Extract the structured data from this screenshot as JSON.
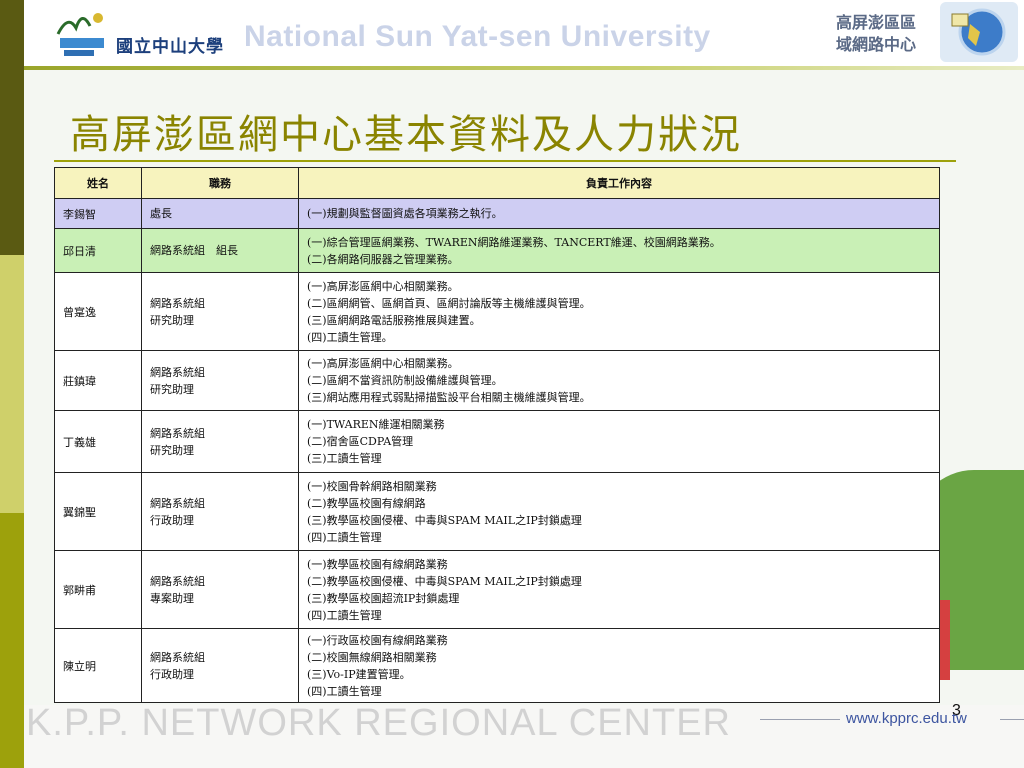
{
  "header": {
    "university_cn": "國立中山大學",
    "university_en": "National Sun Yat-sen University",
    "center_name_line1": "高屏澎區區",
    "center_name_line2": "域網路中心"
  },
  "title": "高屏澎區網中心基本資料及人力狀況",
  "table": {
    "headers": [
      "姓名",
      "職務",
      "負責工作內容"
    ],
    "rows": [
      {
        "name": "李錫智",
        "role": [
          "處長"
        ],
        "duties": [
          "(一)規劃與監督圖資處各項業務之執行。"
        ]
      },
      {
        "name": "邱日清",
        "role": [
          "網路系統組　組長"
        ],
        "duties": [
          "(一)綜合管理區網業務、TWAREN網路維運業務、TANCERT維運、校園網路業務。",
          "(二)各網路伺服器之管理業務。"
        ]
      },
      {
        "name": "曾寔逸",
        "role": [
          "網路系統組",
          "研究助理"
        ],
        "duties": [
          "(一)高屏澎區網中心相關業務。",
          "(二)區網網管、區網首頁、區網討論版等主機維護與管理。",
          "(三)區網網路電話服務推展與建置。",
          "(四)工讀生管理。"
        ]
      },
      {
        "name": "莊鎮瑋",
        "role": [
          "網路系統組",
          "研究助理"
        ],
        "duties": [
          "(一)高屏澎區網中心相關業務。",
          "(二)區網不當資訊防制設備維護與管理。",
          "(三)網站應用程式弱點掃描監設平台相關主機維護與管理。"
        ]
      },
      {
        "name": "丁義雄",
        "role": [
          "網路系統組",
          "研究助理"
        ],
        "duties": [
          "(一)TWAREN維運相關業務",
          "(二)宿舍區CDPA管理",
          "(三)工讀生管理"
        ]
      },
      {
        "name": "翼錦聖",
        "role": [
          "網路系統組",
          "行政助理"
        ],
        "duties": [
          "(一)校園骨幹網路相關業務",
          "(二)教學區校園有線網路",
          "(三)教學區校園侵權、中毒與SPAM MAIL之IP封鎖處理",
          "(四)工讀生管理"
        ]
      },
      {
        "name": "郭畊甫",
        "role": [
          "網路系統組",
          "專案助理"
        ],
        "duties": [
          "(一)教學區校園有線網路業務",
          "(二)教學區校園侵權、中毒與SPAM MAIL之IP封鎖處理",
          "(三)教學區校園超流IP封鎖處理",
          "(四)工讀生管理"
        ]
      },
      {
        "name": "陳立明",
        "role": [
          "網路系統組",
          "行政助理"
        ],
        "duties": [
          "(一)行政區校園有線網路業務",
          "(二)校園無線網路相關業務",
          "(三)Vo-IP建置管理。",
          "(四)工讀生管理"
        ]
      }
    ]
  },
  "footer": {
    "network_text": "K.P.P. NETWORK REGIONAL CENTER",
    "url": "www.kpprc.edu.tw",
    "page_number": "3"
  },
  "colors": {
    "title": "#8a8400",
    "row_director": "#cfcdf3",
    "row_leader": "#c9f0b6",
    "header_row": "#f7f3be"
  }
}
